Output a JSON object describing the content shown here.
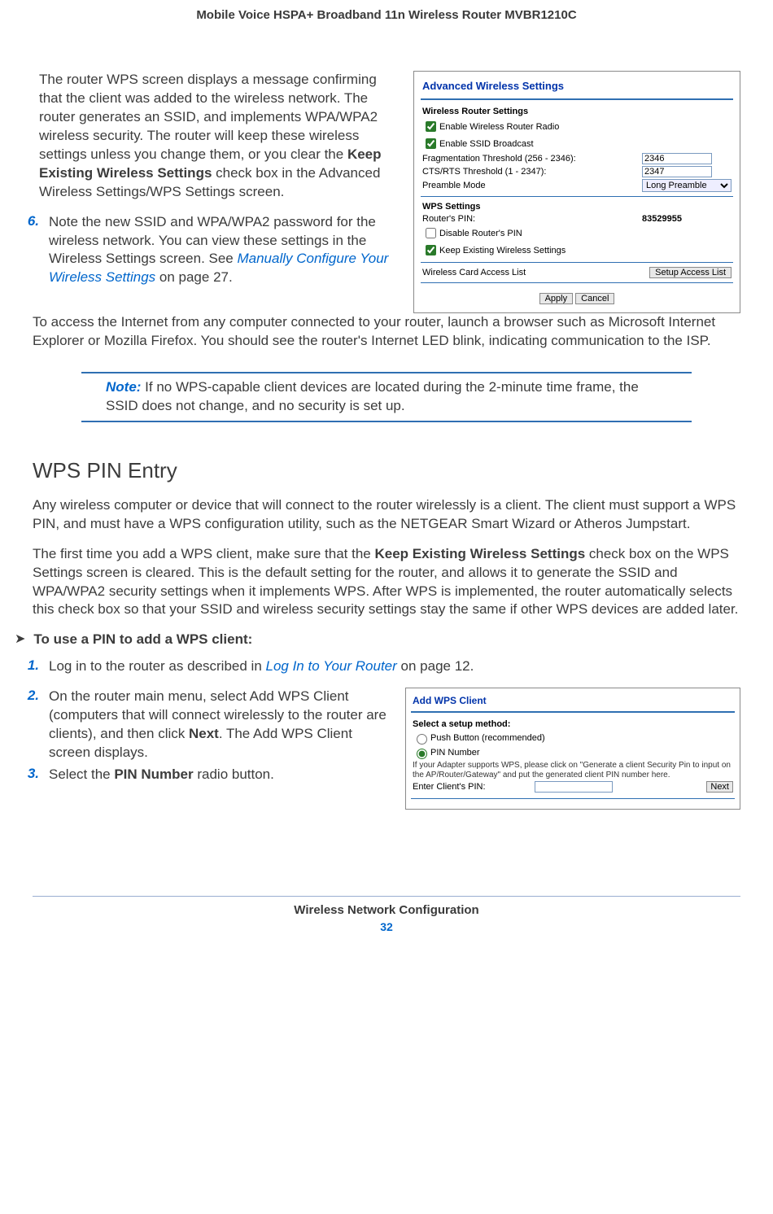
{
  "header": {
    "title": "Mobile Voice HSPA+ Broadband 11n Wireless Router MVBR1210C"
  },
  "para1": {
    "a": "The router WPS screen displays a message confirming that the client was added to the wireless network. The router generates an SSID, and implements WPA/WPA2 wireless security. The router will keep these wireless settings unless you change them, or you clear the ",
    "b": "Keep Existing Wireless Settings",
    "c": " check box in the Advanced Wireless Settings/WPS Settings screen."
  },
  "step6": {
    "num": "6.",
    "a": "Note the new SSID and WPA/WPA2 password for the wireless network. You can view these settings in the Wireless Settings screen. See ",
    "link": "Manually Configure Your Wireless Settings",
    "b": " on page 27."
  },
  "para2": "To access the Internet from any computer connected to your router, launch a browser such as Microsoft Internet Explorer or Mozilla Firefox. You should see the router's Internet LED blink, indicating communication to the ISP.",
  "note": {
    "label": "Note:",
    "text": "  If no WPS-capable client devices are located during the 2-minute time frame, the SSID does not change, and no security is set up."
  },
  "section_title": "WPS PIN Entry",
  "para3": "Any wireless computer or device that will connect to the router wirelessly is a client. The client must support a WPS PIN, and must have a WPS configuration utility, such as the NETGEAR Smart Wizard or Atheros Jumpstart.",
  "para4": {
    "a": "The first time you add a WPS client, make sure that the ",
    "b": "Keep Existing Wireless Settings",
    "c": " check box on the WPS Settings screen is cleared. This is the default setting for the router, and allows it to generate the SSID and WPA/WPA2 security settings when it implements WPS. After WPS is implemented, the router automatically selects this check box so that your SSID and wireless security settings stay the same if other WPS devices are added later."
  },
  "procedure_title": "To use a PIN to add a WPS client:",
  "step1": {
    "num": "1.",
    "a": "Log in to the router as described in ",
    "link": "Log In to Your Router",
    "b": " on page 12."
  },
  "step2": {
    "num": "2.",
    "a": "On the router main menu, select Add WPS Client (computers that will connect wirelessly to the router are clients), and then click ",
    "b": "Next",
    "c": ". The Add WPS Client screen displays."
  },
  "step3": {
    "num": "3.",
    "a": "Select the ",
    "b": "PIN Number",
    "c": " radio button."
  },
  "shot1": {
    "title": "Advanced Wireless Settings",
    "group_router": "Wireless Router Settings",
    "cb_radio": "Enable Wireless Router Radio",
    "cb_ssid": "Enable SSID Broadcast",
    "frag_label": "Fragmentation Threshold (256 - 2346):",
    "frag_val": "2346",
    "cts_label": "CTS/RTS Threshold (1 - 2347):",
    "cts_val": "2347",
    "preamble_label": "Preamble Mode",
    "preamble_val": "Long Preamble",
    "group_wps": "WPS Settings",
    "router_pin_label": "Router's PIN:",
    "router_pin": "83529955",
    "cb_disable_pin": "Disable Router's PIN",
    "cb_keep": "Keep Existing Wireless Settings",
    "access_list_label": "Wireless Card Access List",
    "btn_setup": "Setup Access List",
    "btn_apply": "Apply",
    "btn_cancel": "Cancel"
  },
  "shot2": {
    "title": "Add WPS Client",
    "select_method": "Select a setup method:",
    "opt_push": "Push Button (recommended)",
    "opt_pin": "PIN Number",
    "fine1": "If your Adapter supports WPS, please click on \"Generate a client Security Pin to input on the AP/Router/Gateway\" and put the generated client PIN number here.",
    "enter_pin_label": "Enter Client's PIN:",
    "btn_next": "Next"
  },
  "footer": {
    "title": "Wireless Network Configuration",
    "page": "32"
  }
}
